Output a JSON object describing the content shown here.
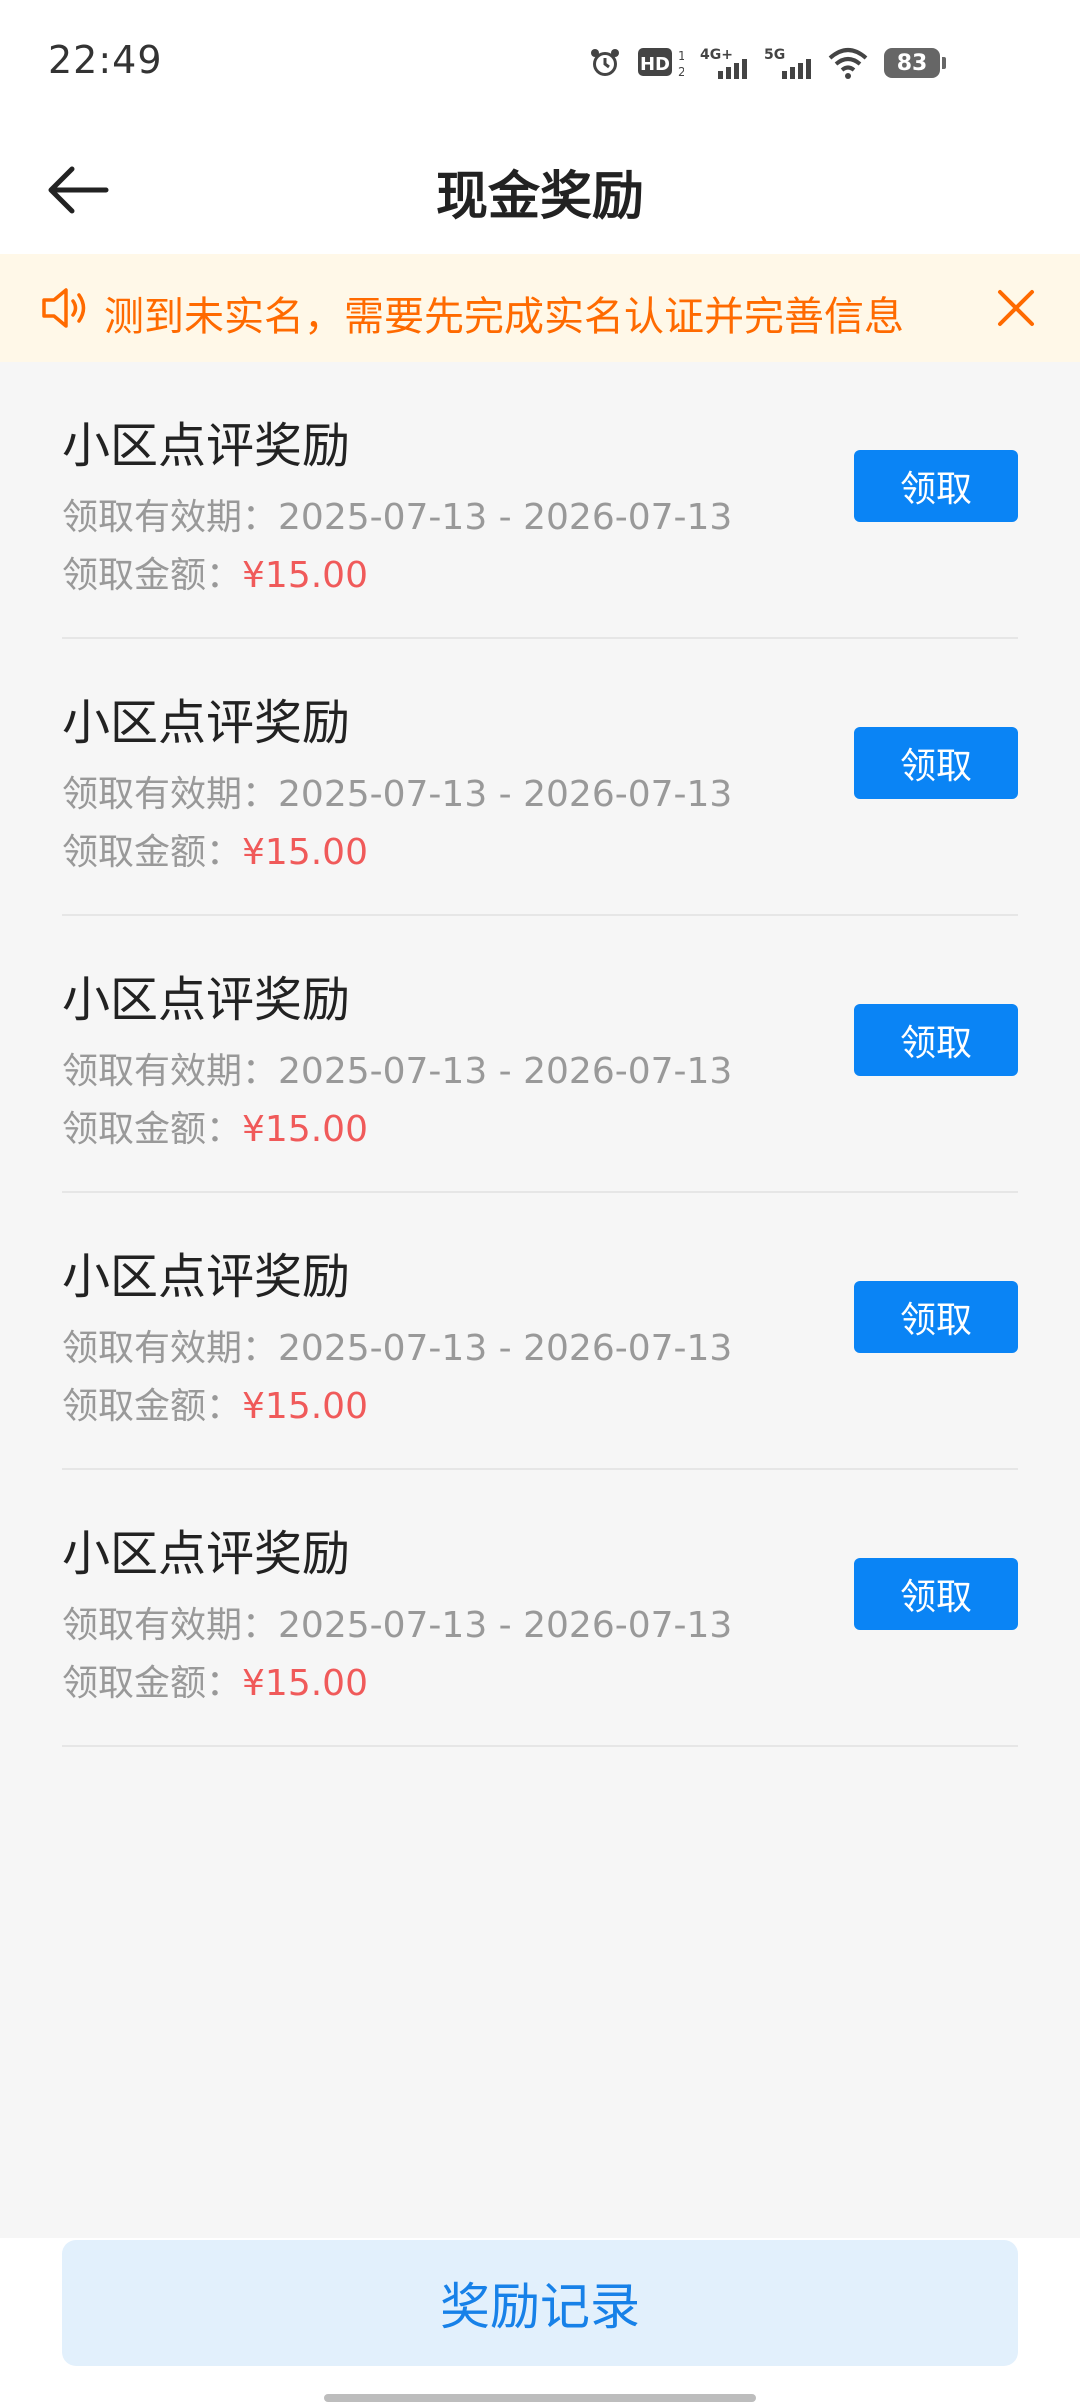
{
  "status_bar": {
    "time": "22:49",
    "icons": [
      "alarm-icon",
      "hd-icon",
      "signal-4g-icon",
      "signal-5g-icon",
      "wifi-icon",
      "battery-icon"
    ],
    "hd_label": "HD",
    "net1_label": "4G+",
    "net2_label": "5G",
    "battery_level": "83"
  },
  "header": {
    "title": "现金奖励"
  },
  "notice": {
    "text": "测到未实名，需要先完成实名认证并完善信息",
    "color": "#ff6a00",
    "background": "#fff8e8"
  },
  "rewards": {
    "items": [
      {
        "title": "小区点评奖励",
        "period_label": "领取有效期：",
        "period_value": "2025-07-13 - 2026-07-13",
        "amount_label": "领取金额：",
        "amount_value": "¥15.00",
        "button_label": "领取"
      },
      {
        "title": "小区点评奖励",
        "period_label": "领取有效期：",
        "period_value": "2025-07-13 - 2026-07-13",
        "amount_label": "领取金额：",
        "amount_value": "¥15.00",
        "button_label": "领取"
      },
      {
        "title": "小区点评奖励",
        "period_label": "领取有效期：",
        "period_value": "2025-07-13 - 2026-07-13",
        "amount_label": "领取金额：",
        "amount_value": "¥15.00",
        "button_label": "领取"
      },
      {
        "title": "小区点评奖励",
        "period_label": "领取有效期：",
        "period_value": "2025-07-13 - 2026-07-13",
        "amount_label": "领取金额：",
        "amount_value": "¥15.00",
        "button_label": "领取"
      },
      {
        "title": "小区点评奖励",
        "period_label": "领取有效期：",
        "period_value": "2025-07-13 - 2026-07-13",
        "amount_label": "领取金额：",
        "amount_value": "¥15.00",
        "button_label": "领取"
      }
    ]
  },
  "footer": {
    "records_button_label": "奖励记录"
  },
  "colors": {
    "accent": "#0a84f5",
    "amount": "#f05a5a",
    "records_button_bg": "#e2f0fc",
    "records_button_text": "#1781e8"
  }
}
